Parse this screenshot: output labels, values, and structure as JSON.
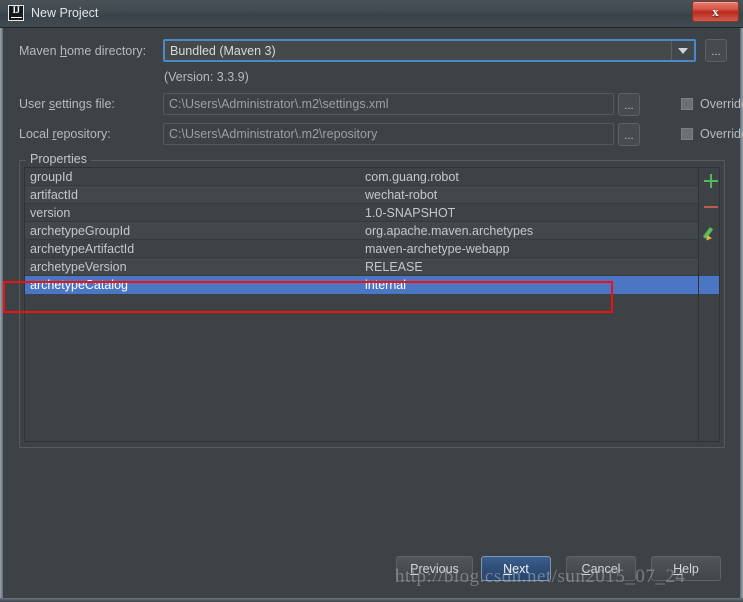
{
  "window": {
    "title": "New Project",
    "app_icon": "intellij-idea-icon",
    "close_label": "x",
    "accent_focus_color": "#4a88c7",
    "selection_color": "#4a76c4",
    "annotation_color": "#ee1111",
    "background_color": "#3c4245"
  },
  "form": {
    "maven_home": {
      "label_pre": "Maven ",
      "label_accel": "h",
      "label_post": "ome directory:",
      "value": "Bundled (Maven 3)",
      "browse_label": "...",
      "version_note": "(Version: 3.3.9)"
    },
    "user_settings": {
      "label_pre": "User ",
      "label_accel": "s",
      "label_post": "ettings file:",
      "value": "C:\\Users\\Administrator\\.m2\\settings.xml",
      "browse_label": "...",
      "override_label": "Override",
      "override_checked": false
    },
    "local_repository": {
      "label_pre": "Local ",
      "label_accel": "r",
      "label_post": "epository:",
      "value": "C:\\Users\\Administrator\\.m2\\repository",
      "browse_label": "...",
      "override_label": "Override",
      "override_checked": false
    }
  },
  "properties": {
    "group_title": "Properties",
    "rows": [
      {
        "key": "groupId",
        "value": "com.guang.robot"
      },
      {
        "key": "artifactId",
        "value": "wechat-robot"
      },
      {
        "key": "version",
        "value": "1.0-SNAPSHOT"
      },
      {
        "key": "archetypeGroupId",
        "value": "org.apache.maven.archetypes"
      },
      {
        "key": "archetypeArtifactId",
        "value": "maven-archetype-webapp"
      },
      {
        "key": "archetypeVersion",
        "value": "RELEASE"
      },
      {
        "key": "archetypeCatalog",
        "value": "internal"
      }
    ],
    "selected_index": 6,
    "actions": {
      "add": "add-icon",
      "remove": "remove-icon",
      "edit": "edit-pencil-icon"
    }
  },
  "footer": {
    "buttons": [
      {
        "pre": "",
        "accel": "P",
        "post": "revious",
        "default": false
      },
      {
        "pre": "",
        "accel": "N",
        "post": "ext",
        "default": true
      },
      {
        "pre": "",
        "accel": "C",
        "post": "ancel",
        "default": false
      },
      {
        "pre": "",
        "accel": "H",
        "post": "elp",
        "default": false
      }
    ]
  },
  "watermark": {
    "text": "http://blog.csdn.net/sun2015_07_24"
  }
}
